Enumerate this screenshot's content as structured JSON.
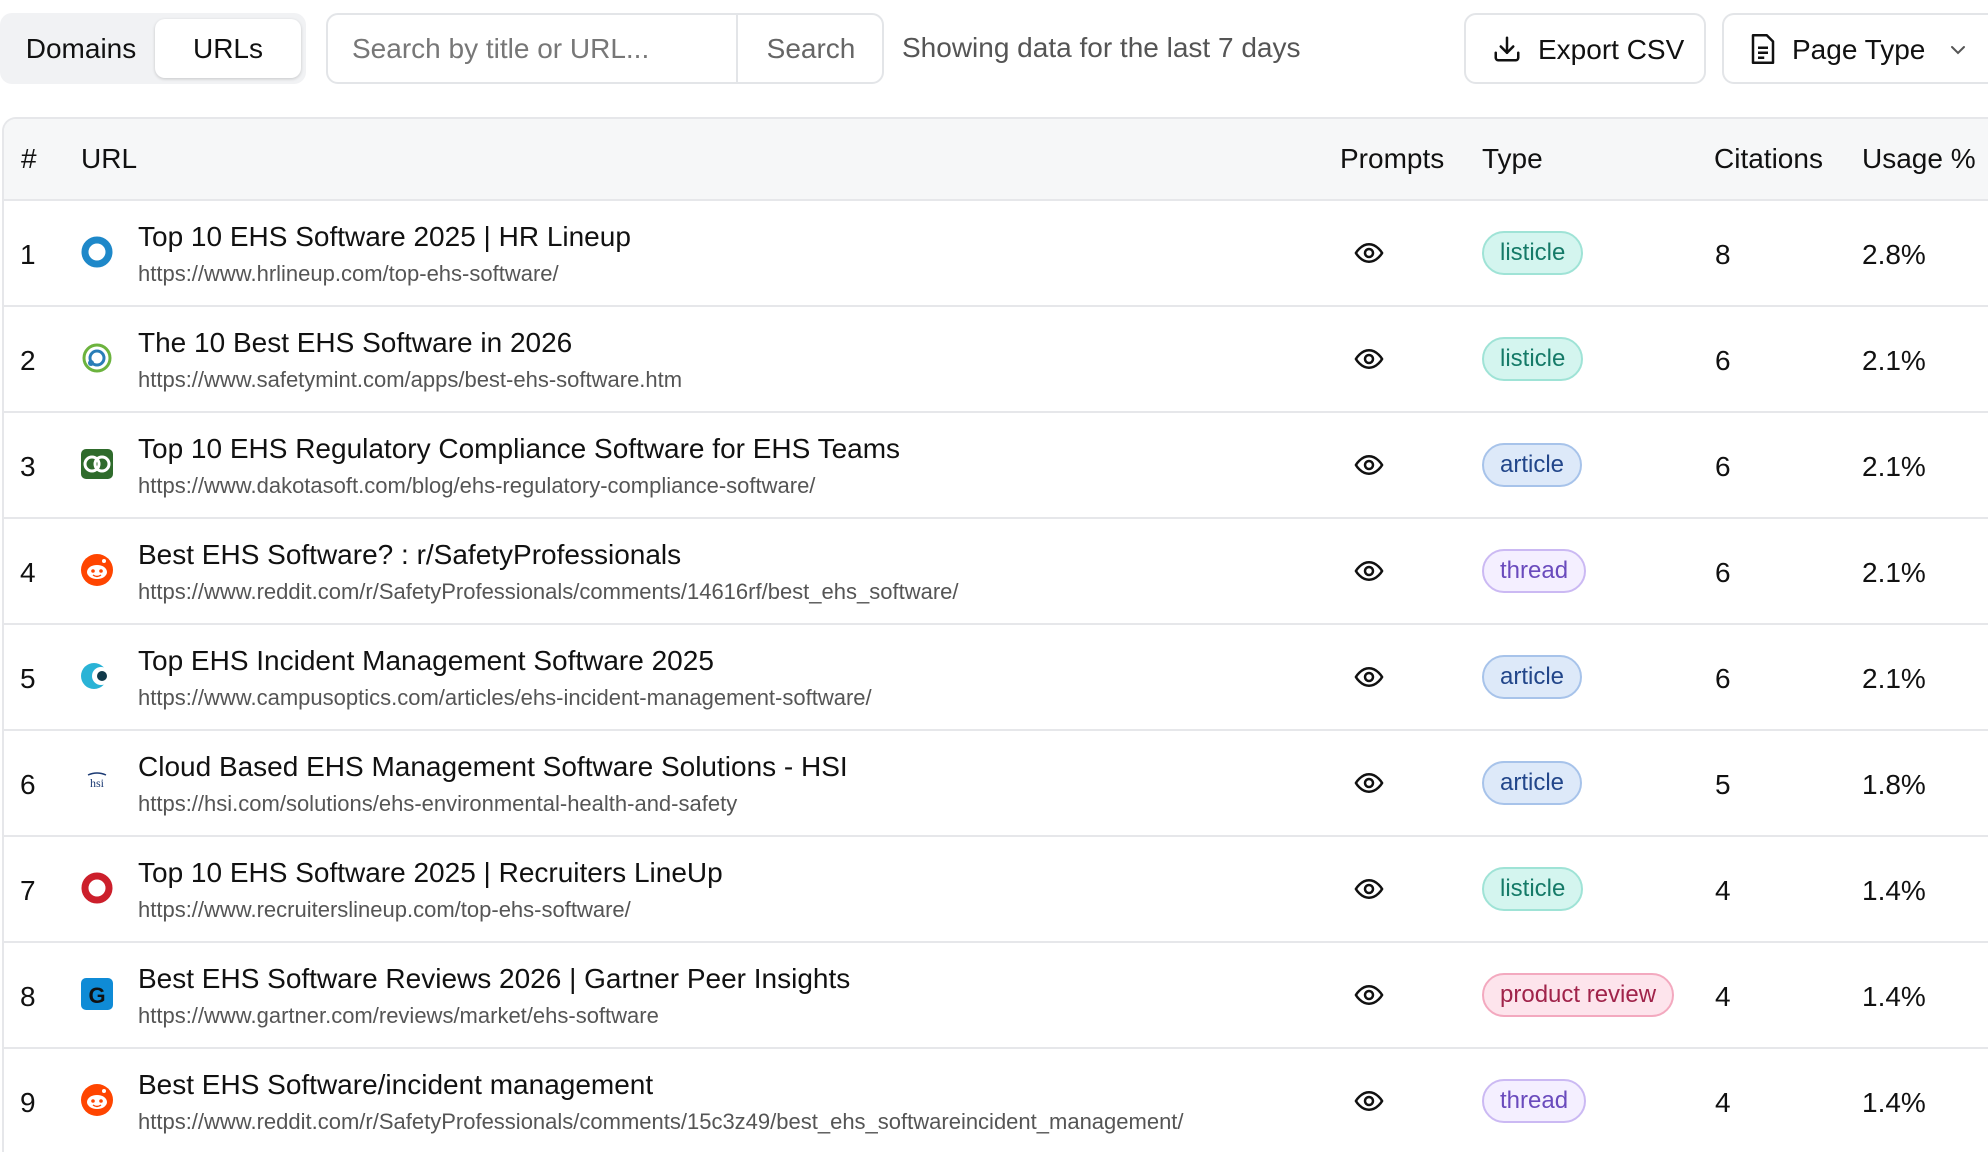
{
  "view_toggle": {
    "domains": "Domains",
    "urls": "URLs",
    "active": "URLs"
  },
  "search": {
    "placeholder": "Search by title or URL...",
    "value": "",
    "button": "Search"
  },
  "range_text": "Showing data for the last 7 days",
  "export_label": "Export CSV",
  "page_type_label": "Page Type",
  "columns": {
    "num": "#",
    "url": "URL",
    "prompts": "Prompts",
    "type": "Type",
    "citations": "Citations",
    "usage": "Usage %"
  },
  "badge_colors": {
    "listicle": "#d4f5ef",
    "article": "#dde9f9",
    "thread": "#f4efff",
    "product review": "#fde4ec"
  },
  "rows": [
    {
      "num": "1",
      "favicon": "hrlineup-ring-icon",
      "title": "Top 10 EHS Software 2025 | HR Lineup",
      "url": "https://www.hrlineup.com/top-ehs-software/",
      "type": "listicle",
      "citations": "8",
      "usage": "2.8%"
    },
    {
      "num": "2",
      "favicon": "safetymint-icon",
      "title": "The 10 Best EHS Software in 2026",
      "url": "https://www.safetymint.com/apps/best-ehs-software.htm",
      "type": "listicle",
      "citations": "6",
      "usage": "2.1%"
    },
    {
      "num": "3",
      "favicon": "dakota-icon",
      "title": "Top 10 EHS Regulatory Compliance Software for EHS Teams",
      "url": "https://www.dakotasoft.com/blog/ehs-regulatory-compliance-software/",
      "type": "article",
      "citations": "6",
      "usage": "2.1%"
    },
    {
      "num": "4",
      "favicon": "reddit-icon",
      "title": "Best EHS Software? : r/SafetyProfessionals",
      "url": "https://www.reddit.com/r/SafetyProfessionals/comments/14616rf/best_ehs_software/",
      "type": "thread",
      "citations": "6",
      "usage": "2.1%"
    },
    {
      "num": "5",
      "favicon": "campusoptics-icon",
      "title": "Top EHS Incident Management Software 2025",
      "url": "https://www.campusoptics.com/articles/ehs-incident-management-software/",
      "type": "article",
      "citations": "6",
      "usage": "2.1%"
    },
    {
      "num": "6",
      "favicon": "hsi-icon",
      "title": "Cloud Based EHS Management Software Solutions - HSI",
      "url": "https://hsi.com/solutions/ehs-environmental-health-and-safety",
      "type": "article",
      "citations": "5",
      "usage": "1.8%"
    },
    {
      "num": "7",
      "favicon": "recruiterslineup-ring-icon",
      "title": "Top 10 EHS Software 2025 | Recruiters LineUp",
      "url": "https://www.recruiterslineup.com/top-ehs-software/",
      "type": "listicle",
      "citations": "4",
      "usage": "1.4%"
    },
    {
      "num": "8",
      "favicon": "gartner-icon",
      "title": "Best EHS Software Reviews 2026 | Gartner Peer Insights",
      "url": "https://www.gartner.com/reviews/market/ehs-software",
      "type": "product review",
      "citations": "4",
      "usage": "1.4%"
    },
    {
      "num": "9",
      "favicon": "reddit-icon",
      "title": "Best EHS Software/incident management",
      "url": "https://www.reddit.com/r/SafetyProfessionals/comments/15c3z49/best_ehs_softwareincident_management/",
      "type": "thread",
      "citations": "4",
      "usage": "1.4%"
    }
  ]
}
